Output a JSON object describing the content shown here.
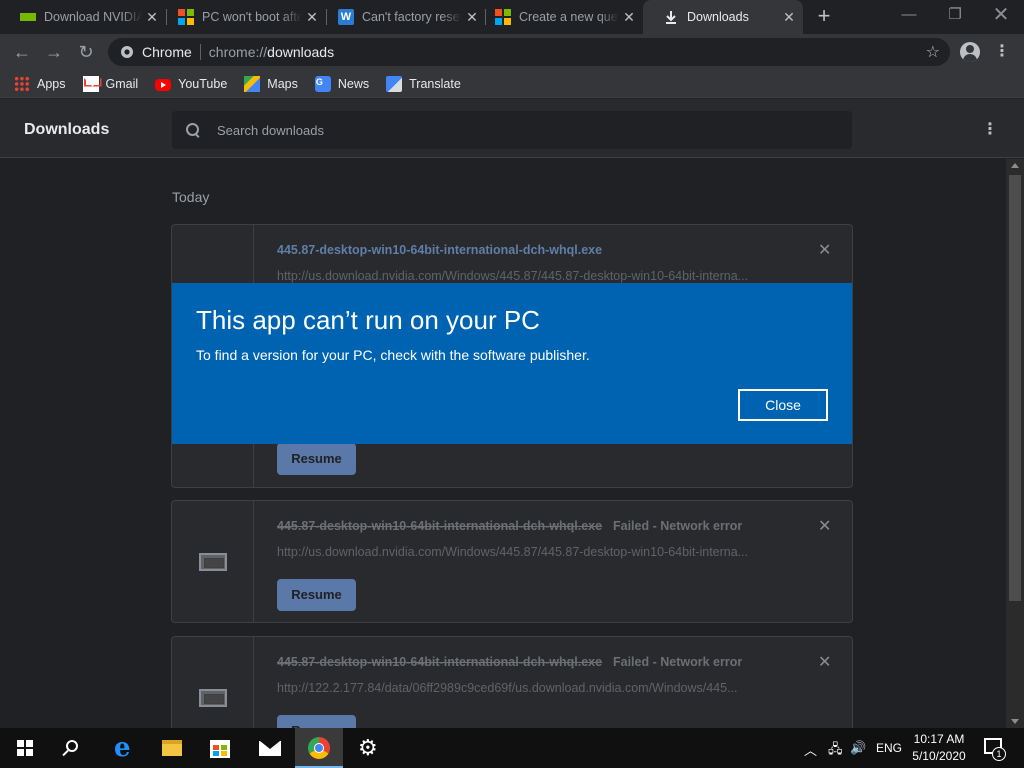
{
  "browser": {
    "tabs": [
      {
        "label": "Download NVIDIA",
        "favicon": "nvidia-icon",
        "active": false
      },
      {
        "label": "PC won't boot after",
        "favicon": "microsoft-icon",
        "active": false
      },
      {
        "label": "Can't factory reset",
        "favicon": "w-icon",
        "favicon_text": "W",
        "active": false
      },
      {
        "label": "Create a new question",
        "favicon": "microsoft-icon",
        "active": false
      },
      {
        "label": "Downloads",
        "favicon": "download-icon",
        "active": true
      }
    ],
    "omnibox": {
      "site_label": "Chrome",
      "url_scheme": "chrome://",
      "url_host": "downloads"
    },
    "bookmarks": [
      {
        "label": "Apps",
        "icon": "apps-icon"
      },
      {
        "label": "Gmail",
        "icon": "gmail-icon"
      },
      {
        "label": "YouTube",
        "icon": "youtube-icon"
      },
      {
        "label": "Maps",
        "icon": "maps-icon"
      },
      {
        "label": "News",
        "icon": "news-icon"
      },
      {
        "label": "Translate",
        "icon": "translate-icon"
      }
    ]
  },
  "downloads": {
    "title": "Downloads",
    "search_placeholder": "Search downloads",
    "group_label": "Today",
    "items": [
      {
        "name": "445.87-desktop-win10-64bit-international-dch-whql.exe",
        "status": "",
        "url": "http://us.download.nvidia.com/Windows/445.87/445.87-desktop-win10-64bit-interna...",
        "action": "Resume"
      },
      {
        "name": "445.87-desktop-win10-64bit-international-dch-whql.exe",
        "status": "Failed - Network error",
        "url": "http://us.download.nvidia.com/Windows/445.87/445.87-desktop-win10-64bit-interna...",
        "action": "Resume"
      },
      {
        "name": "445.87-desktop-win10-64bit-international-dch-whql.exe",
        "status": "Failed - Network error",
        "url": "http://122.2.177.84/data/06ff2989c9ced69f/us.download.nvidia.com/Windows/445...",
        "action": "Resume"
      }
    ]
  },
  "dialog": {
    "title": "This app can’t run on your PC",
    "message": "To find a version for your PC, check with the software publisher.",
    "close_label": "Close",
    "background_color": "#0063b1"
  },
  "taskbar": {
    "language": "ENG",
    "time": "10:17 AM",
    "date": "5/10/2020",
    "notification_count": "1"
  }
}
